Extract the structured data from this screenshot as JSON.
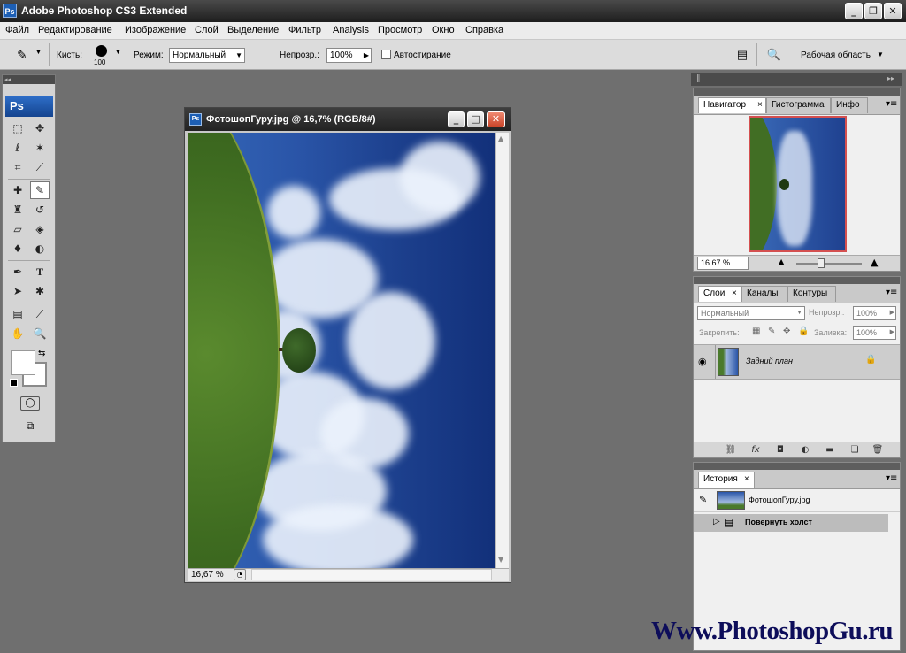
{
  "app": {
    "icon_label": "Ps",
    "title": "Adobe Photoshop CS3 Extended",
    "window_buttons": {
      "minimize": "_",
      "restore": "❐",
      "close": "✕"
    }
  },
  "menubar": {
    "items": [
      "Файл",
      "Редактирование",
      "Изображение",
      "Слой",
      "Выделение",
      "Фильтр",
      "Analysis",
      "Просмотр",
      "Окно",
      "Справка"
    ]
  },
  "options_bar": {
    "brush_label": "Кисть:",
    "brush_size": "100",
    "mode_label": "Режим:",
    "mode_value": "Нормальный",
    "opacity_label": "Непрозр.:",
    "opacity_value": "100%",
    "auto_erase_label": "Автостирание",
    "workspace_label": "Рабочая область"
  },
  "toolbox": {
    "logo": "Ps",
    "head_arrows": "◂◂"
  },
  "document": {
    "title": "ФотошопГуру.jpg @ 16,7% (RGB/8#)",
    "zoom": "16,67 %"
  },
  "panels": {
    "arrows": "▸▸",
    "navigator": {
      "tabs": [
        "Навигатор",
        "Гистограмма",
        "Инфо"
      ],
      "zoom": "16.67 %"
    },
    "layers": {
      "tabs": [
        "Слои",
        "Каналы",
        "Контуры"
      ],
      "blend_mode": "Нормальный",
      "opacity_label": "Непрозр.:",
      "opacity_value": "100%",
      "lock_label": "Закрепить:",
      "fill_label": "Заливка:",
      "fill_value": "100%",
      "layer_name": "Задний план"
    },
    "history": {
      "tabs": [
        "История"
      ],
      "snapshot_name": "ФотошопГуру.jpg",
      "step_name": "Повернуть холст"
    }
  },
  "watermark": "Www.PhotoshopGu.ru"
}
